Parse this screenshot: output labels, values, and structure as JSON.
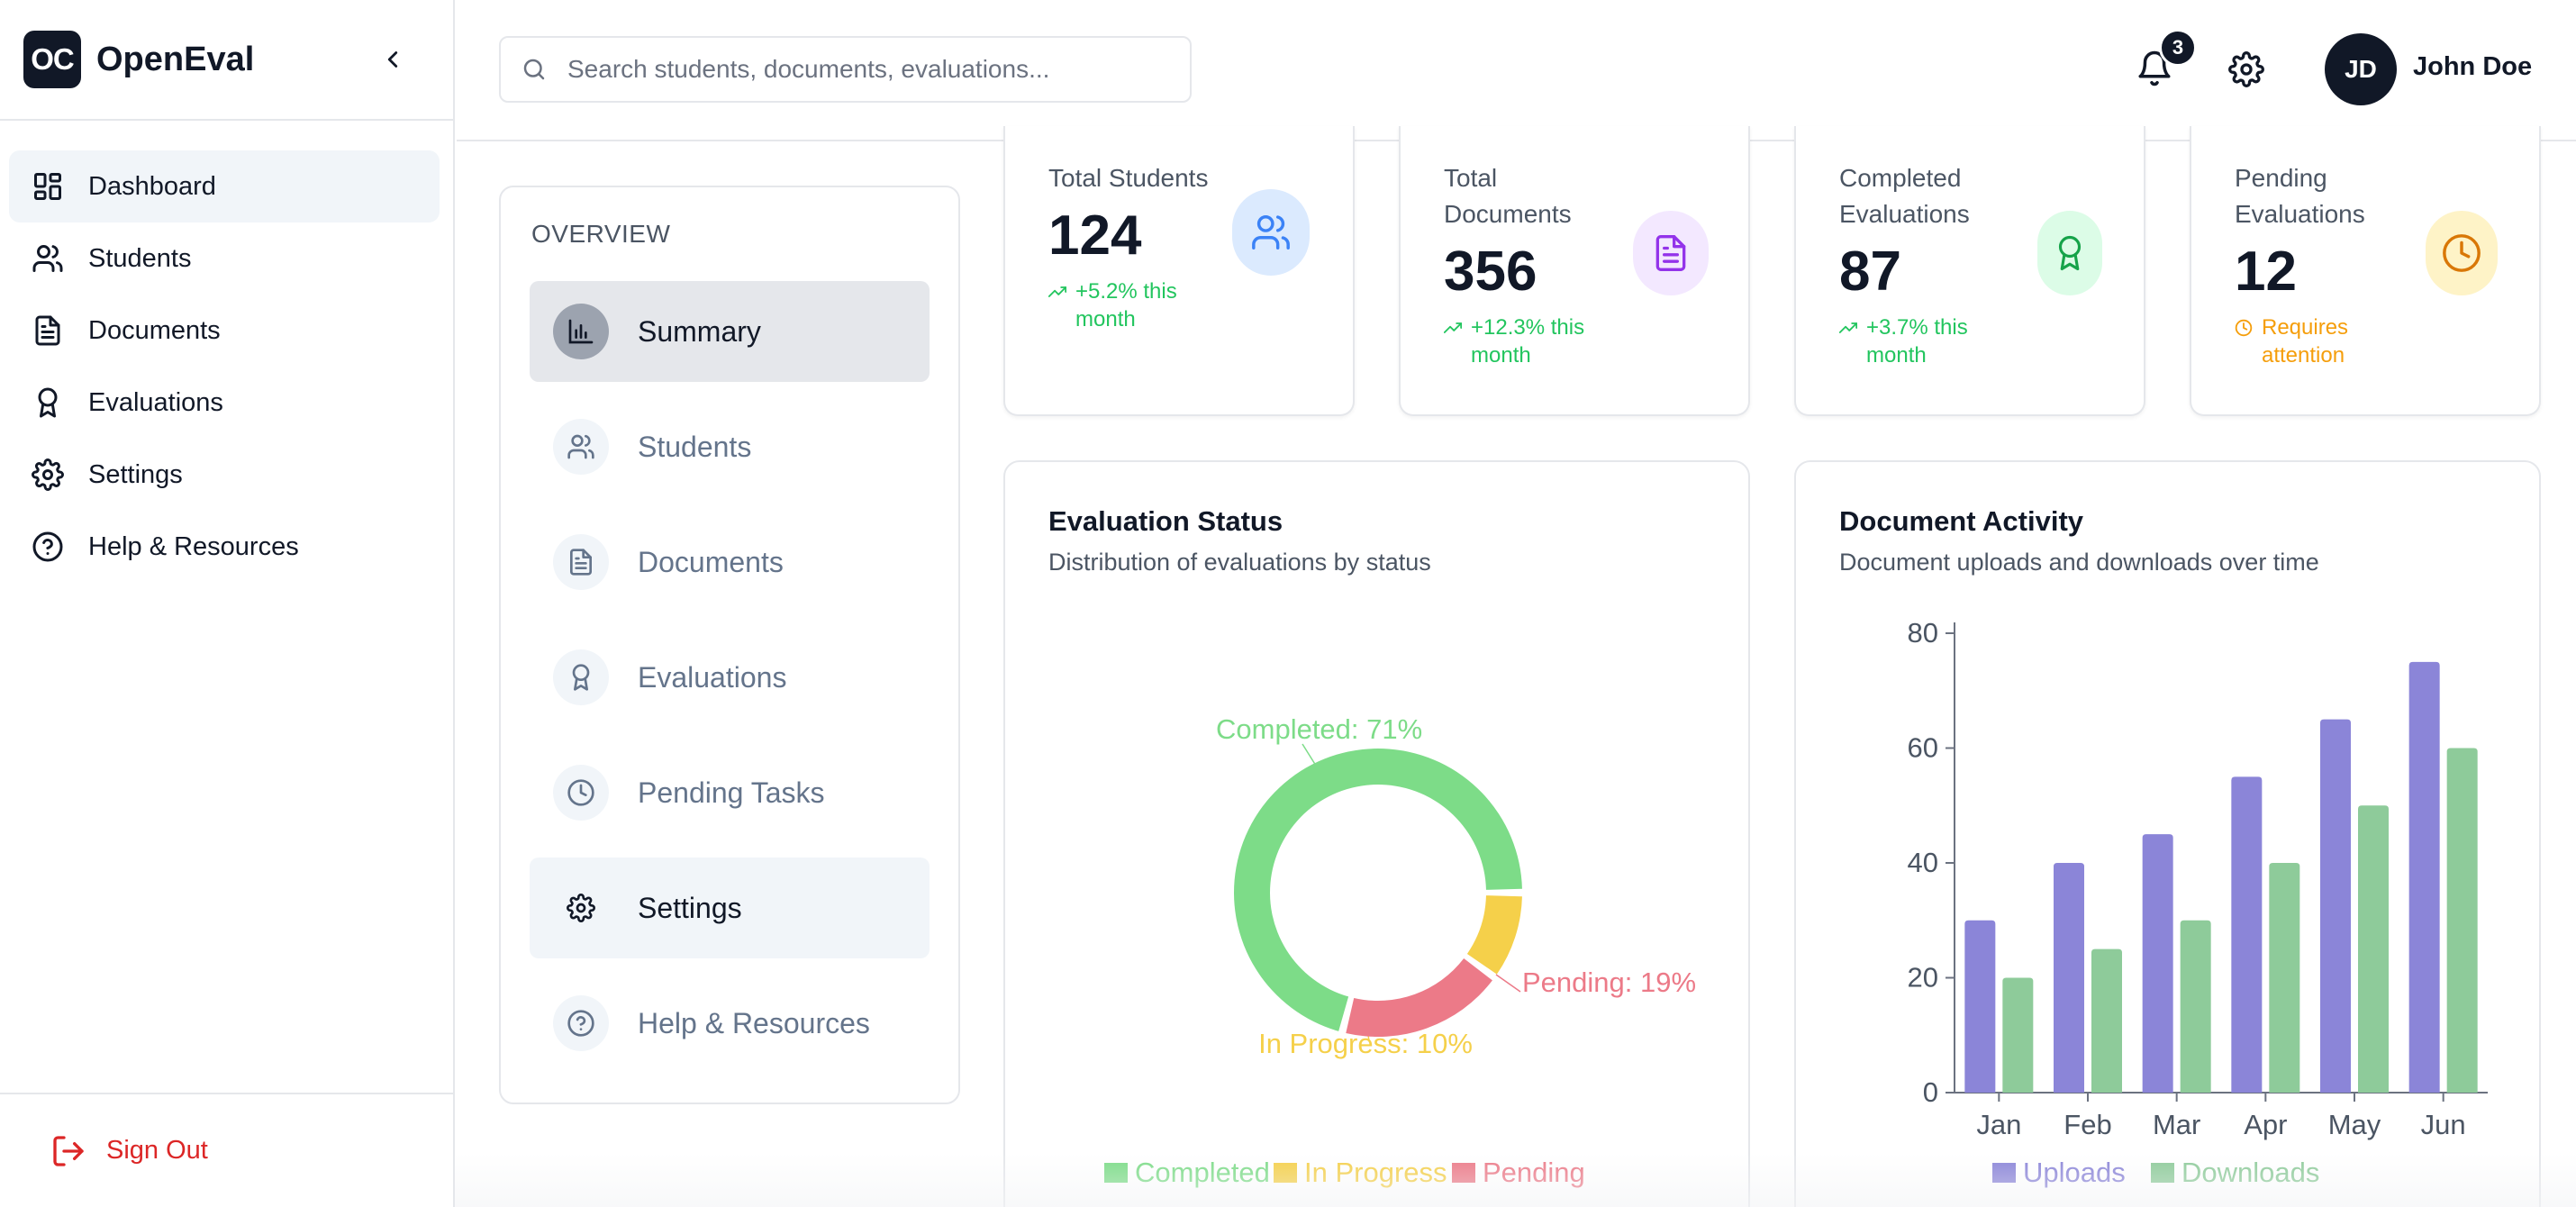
{
  "brand": {
    "logo_text": "OC",
    "name": "OpenEval"
  },
  "sidebar": {
    "items": [
      {
        "label": "Dashboard",
        "icon": "layout-dashboard-icon",
        "active": true
      },
      {
        "label": "Students",
        "icon": "users-icon"
      },
      {
        "label": "Documents",
        "icon": "file-text-icon"
      },
      {
        "label": "Evaluations",
        "icon": "award-icon"
      },
      {
        "label": "Settings",
        "icon": "gear-icon"
      },
      {
        "label": "Help & Resources",
        "icon": "help-circle-icon"
      }
    ],
    "sign_out": "Sign Out"
  },
  "header": {
    "search_placeholder": "Search students, documents, evaluations...",
    "notification_count": "3",
    "user_initials": "JD",
    "user_name": "John Doe"
  },
  "overview": {
    "title": "OVERVIEW",
    "items": [
      {
        "label": "Summary",
        "icon": "bar-chart-icon",
        "state": "active"
      },
      {
        "label": "Students",
        "icon": "users-icon"
      },
      {
        "label": "Documents",
        "icon": "file-text-icon"
      },
      {
        "label": "Evaluations",
        "icon": "award-icon"
      },
      {
        "label": "Pending Tasks",
        "icon": "clock-icon"
      },
      {
        "label": "Settings",
        "icon": "gear-icon",
        "state": "hover"
      },
      {
        "label": "Help & Resources",
        "icon": "help-circle-icon"
      }
    ]
  },
  "stats": [
    {
      "title": "Total Students",
      "value": "124",
      "trend": "+5.2% this month",
      "icon": "users-icon",
      "color": "#3b82f6",
      "bg": "#dbeafe"
    },
    {
      "title": "Total Documents",
      "value": "356",
      "trend": "+12.3% this month",
      "icon": "file-text-icon",
      "color": "#9333ea",
      "bg": "#f3e8ff"
    },
    {
      "title": "Completed Evaluations",
      "value": "87",
      "trend": "+3.7% this month",
      "icon": "award-icon",
      "color": "#16a34a",
      "bg": "#dcfce7"
    },
    {
      "title": "Pending Evaluations",
      "value": "12",
      "trend": "Requires attention",
      "icon": "clock-icon",
      "color": "#d97706",
      "bg": "#fef3c7"
    }
  ],
  "evaluation_status": {
    "title": "Evaluation Status",
    "subtitle": "Distribution of evaluations by status"
  },
  "document_activity": {
    "title": "Document Activity",
    "subtitle": "Document uploads and downloads over time"
  },
  "chart_data": [
    {
      "type": "pie",
      "title": "Evaluation Status",
      "categories": [
        "Completed",
        "In Progress",
        "Pending"
      ],
      "values": [
        71,
        10,
        19
      ],
      "data_labels": [
        "Completed: 71%",
        "In Progress: 10%",
        "Pending: 19%"
      ],
      "colors": [
        "#7ddc88",
        "#f5d04a",
        "#ec7a88"
      ],
      "legend": "bottom"
    },
    {
      "type": "bar",
      "title": "Document Activity",
      "categories": [
        "Jan",
        "Feb",
        "Mar",
        "Apr",
        "May",
        "Jun"
      ],
      "series": [
        {
          "name": "Uploads",
          "values": [
            30,
            40,
            45,
            55,
            65,
            75
          ],
          "color": "#8b85d8"
        },
        {
          "name": "Downloads",
          "values": [
            20,
            25,
            30,
            40,
            50,
            60
          ],
          "color": "#8ecb9a"
        }
      ],
      "yticks": [
        "0",
        "20",
        "40",
        "60",
        "80"
      ],
      "ylim": [
        0,
        80
      ],
      "legend": "bottom",
      "grid": false
    }
  ]
}
